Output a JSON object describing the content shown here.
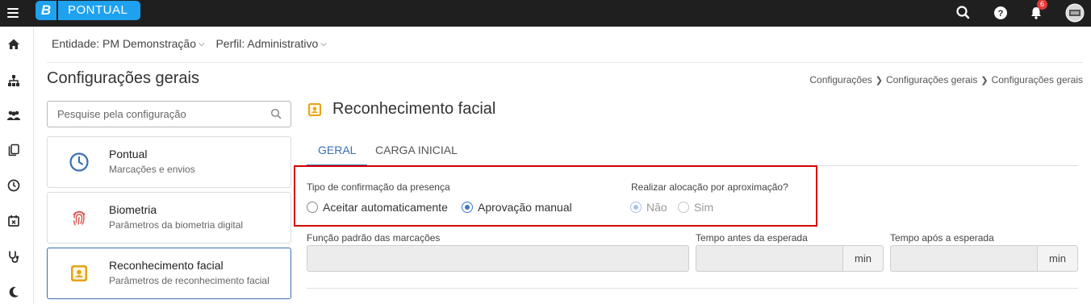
{
  "app": {
    "logo_letter": "B",
    "name": "PONTUAL",
    "notifications_count": "6",
    "brand_color": "#1ea1ef",
    "accent_color": "#3b6fb3"
  },
  "topbar_icons": [
    "menu-icon",
    "search-icon",
    "help-icon",
    "bell-icon",
    "avatar"
  ],
  "rail_icons": [
    "home-icon",
    "org-chart-icon",
    "people-icon",
    "copy-icon",
    "clock-icon",
    "calendar-x-icon",
    "stethoscope-icon",
    "moon-icon"
  ],
  "context": {
    "entity_label": "Entidade: PM Demonstração",
    "profile_label": "Perfil: Administrativo"
  },
  "page_title": "Configurações gerais",
  "breadcrumb": [
    "Configurações",
    "Configurações gerais",
    "Configurações gerais"
  ],
  "search": {
    "placeholder": "Pesquise pela configuração"
  },
  "cards": [
    {
      "title": "Pontual",
      "subtitle": "Marcações e envios",
      "icon": "clock-icon"
    },
    {
      "title": "Biometria",
      "subtitle": "Parâmetros da biometria digital",
      "icon": "fingerprint-icon"
    },
    {
      "title": "Reconhecimento facial",
      "subtitle": "Parâmetros de reconhecimento facial",
      "icon": "face-id-icon",
      "active": true
    }
  ],
  "section": {
    "title": "Reconhecimento facial",
    "tabs": [
      "GERAL",
      "CARGA INICIAL"
    ],
    "active_tab": "GERAL"
  },
  "form": {
    "confirmation": {
      "label": "Tipo de confirmação da presença",
      "options": [
        "Aceitar automaticamente",
        "Aprovação manual"
      ],
      "selected": "Aprovação manual"
    },
    "allocation": {
      "label": "Realizar alocação por aproximação?",
      "options": [
        "Não",
        "Sim"
      ],
      "selected": "Não",
      "disabled": true
    },
    "default_function": {
      "label": "Função padrão das marcações",
      "value": ""
    },
    "time_before": {
      "label": "Tempo antes da esperada",
      "value": "",
      "unit": "min"
    },
    "time_after": {
      "label": "Tempo após a esperada",
      "value": "",
      "unit": "min"
    }
  }
}
